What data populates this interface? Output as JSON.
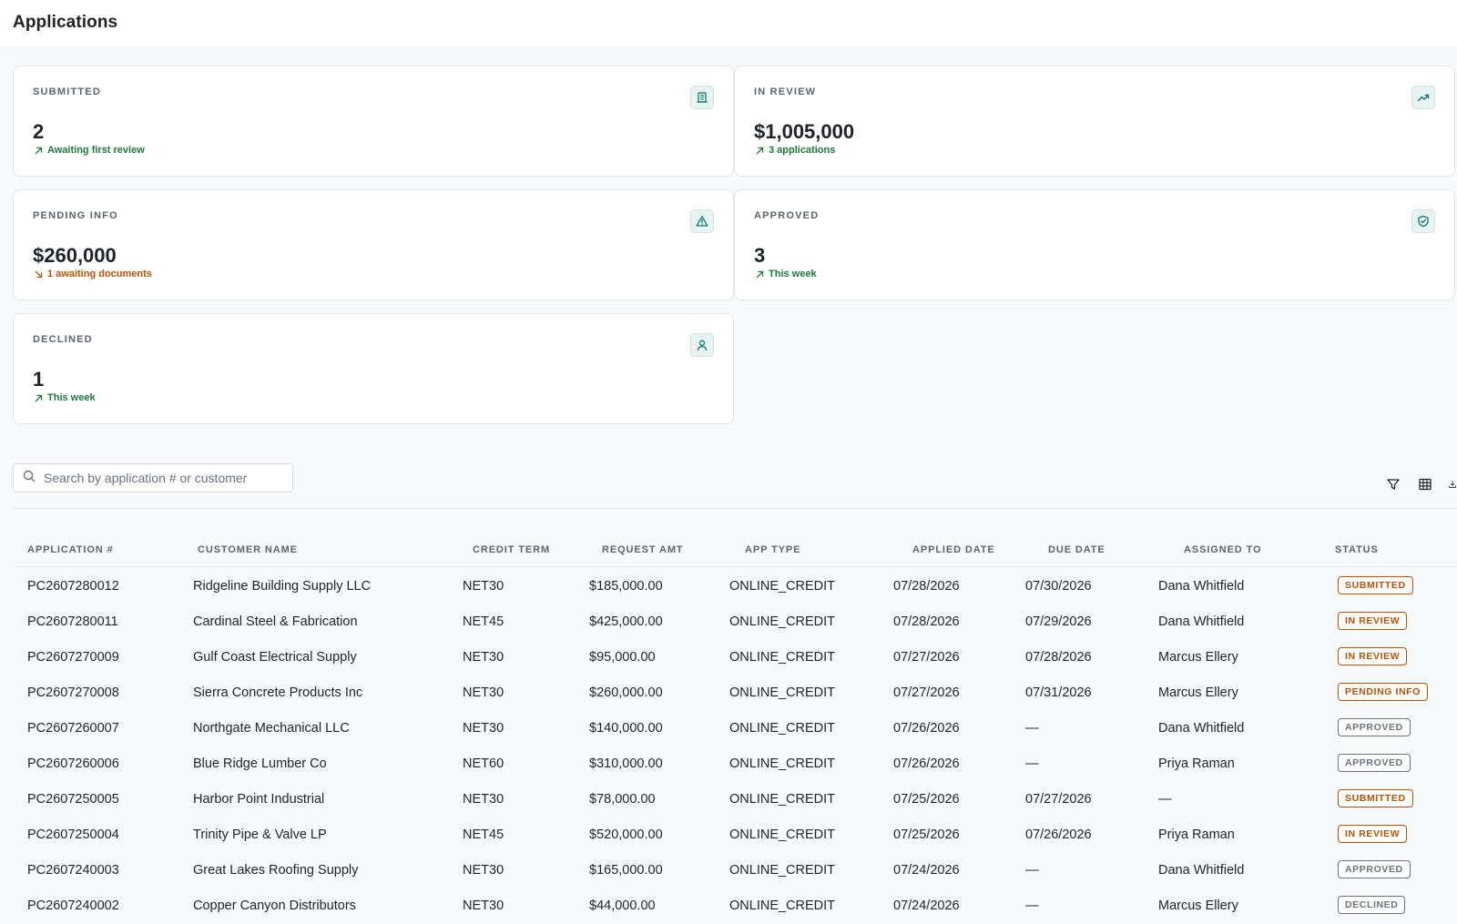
{
  "header": {
    "title": "Applications"
  },
  "cards": [
    {
      "label": "SUBMITTED",
      "value": "2",
      "sub": "Awaiting first review",
      "trend": "up",
      "icon": "building-icon"
    },
    {
      "label": "IN REVIEW",
      "value": "$1,005,000",
      "sub": "3 applications",
      "trend": "up",
      "icon": "trending-up-icon"
    },
    {
      "label": "PENDING INFO",
      "value": "$260,000",
      "sub": "1 awaiting documents",
      "trend": "down",
      "icon": "warning-triangle-icon"
    },
    {
      "label": "APPROVED",
      "value": "3",
      "sub": "This week",
      "trend": "up",
      "icon": "shield-check-icon"
    },
    {
      "label": "DECLINED",
      "value": "1",
      "sub": "This week",
      "trend": "up",
      "icon": "user-icon"
    }
  ],
  "colors": {
    "trend_up": "#1f7a3d",
    "trend_down": "#b45309",
    "icon_accent": "#0f766e",
    "status_active": "#b45309",
    "status_neutral": "#6b7280"
  },
  "search": {
    "placeholder": "Search by application # or customer",
    "value": ""
  },
  "toolbar": {
    "icons": [
      "filter-icon",
      "columns-icon",
      "download-icon"
    ]
  },
  "table": {
    "columns": [
      "APPLICATION #",
      "CUSTOMER NAME",
      "CREDIT TERM",
      "REQUEST AMT",
      "APP TYPE",
      "APPLIED DATE",
      "DUE DATE",
      "ASSIGNED TO",
      "STATUS"
    ],
    "rows": [
      {
        "app": "PC2607280012",
        "customer": "Ridgeline Building Supply LLC",
        "term": "NET30",
        "amount": "$185,000.00",
        "type": "ONLINE_CREDIT",
        "applied": "07/28/2026",
        "due": "07/30/2026",
        "assigned": "Dana Whitfield",
        "status": "SUBMITTED",
        "tone": "active"
      },
      {
        "app": "PC2607280011",
        "customer": "Cardinal Steel & Fabrication",
        "term": "NET45",
        "amount": "$425,000.00",
        "type": "ONLINE_CREDIT",
        "applied": "07/28/2026",
        "due": "07/29/2026",
        "assigned": "Dana Whitfield",
        "status": "IN REVIEW",
        "tone": "active"
      },
      {
        "app": "PC2607270009",
        "customer": "Gulf Coast Electrical Supply",
        "term": "NET30",
        "amount": "$95,000.00",
        "type": "ONLINE_CREDIT",
        "applied": "07/27/2026",
        "due": "07/28/2026",
        "assigned": "Marcus Ellery",
        "status": "IN REVIEW",
        "tone": "active"
      },
      {
        "app": "PC2607270008",
        "customer": "Sierra Concrete Products Inc",
        "term": "NET30",
        "amount": "$260,000.00",
        "type": "ONLINE_CREDIT",
        "applied": "07/27/2026",
        "due": "07/31/2026",
        "assigned": "Marcus Ellery",
        "status": "PENDING INFO",
        "tone": "active"
      },
      {
        "app": "PC2607260007",
        "customer": "Northgate Mechanical LLC",
        "term": "NET30",
        "amount": "$140,000.00",
        "type": "ONLINE_CREDIT",
        "applied": "07/26/2026",
        "due": "—",
        "assigned": "Dana Whitfield",
        "status": "APPROVED",
        "tone": "neutral"
      },
      {
        "app": "PC2607260006",
        "customer": "Blue Ridge Lumber Co",
        "term": "NET60",
        "amount": "$310,000.00",
        "type": "ONLINE_CREDIT",
        "applied": "07/26/2026",
        "due": "—",
        "assigned": "Priya Raman",
        "status": "APPROVED",
        "tone": "neutral"
      },
      {
        "app": "PC2607250005",
        "customer": "Harbor Point Industrial",
        "term": "NET30",
        "amount": "$78,000.00",
        "type": "ONLINE_CREDIT",
        "applied": "07/25/2026",
        "due": "07/27/2026",
        "assigned": "—",
        "status": "SUBMITTED",
        "tone": "active"
      },
      {
        "app": "PC2607250004",
        "customer": "Trinity Pipe & Valve LP",
        "term": "NET45",
        "amount": "$520,000.00",
        "type": "ONLINE_CREDIT",
        "applied": "07/25/2026",
        "due": "07/26/2026",
        "assigned": "Priya Raman",
        "status": "IN REVIEW",
        "tone": "active"
      },
      {
        "app": "PC2607240003",
        "customer": "Great Lakes Roofing Supply",
        "term": "NET30",
        "amount": "$165,000.00",
        "type": "ONLINE_CREDIT",
        "applied": "07/24/2026",
        "due": "—",
        "assigned": "Dana Whitfield",
        "status": "APPROVED",
        "tone": "neutral"
      },
      {
        "app": "PC2607240002",
        "customer": "Copper Canyon Distributors",
        "term": "NET30",
        "amount": "$44,000.00",
        "type": "ONLINE_CREDIT",
        "applied": "07/24/2026",
        "due": "—",
        "assigned": "Marcus Ellery",
        "status": "DECLINED",
        "tone": "neutral"
      }
    ]
  }
}
